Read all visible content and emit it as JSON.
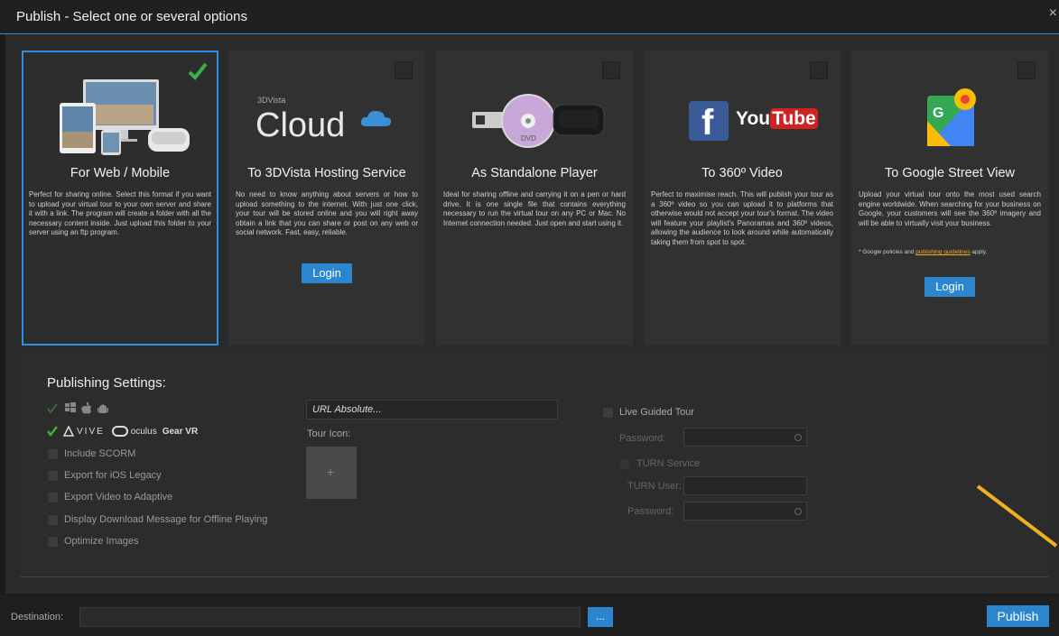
{
  "window": {
    "title": "Publish - Select one or several options",
    "close": "×"
  },
  "cards": [
    {
      "title": "For Web / Mobile",
      "checked": true,
      "desc": "Perfect for sharing online. Select this format if you want to upload your virtual tour to your own server and share it with a link. The program will create a folder with all the necessary content inside. Just upload this folder to your server using an ftp program."
    },
    {
      "title": "To 3DVista Hosting Service",
      "checked": false,
      "logo_small": "3DVista",
      "logo_big": "Cloud",
      "desc": "No need to know anything about servers or how to upload something to the internet. With just one click, your tour will be stored online and you will right away obtain a link that you can share or post on any web or social network. Fast, easy, reliable.",
      "login": "Login"
    },
    {
      "title": "As Standalone Player",
      "checked": false,
      "desc": "Ideal for sharing offline and carrying it on a pen or hard drive. It is one single file that contains everything necessary to run the virtual tour on any PC or Mac. No Internet connection needed. Just open and start using it.",
      "dvd": "DVD"
    },
    {
      "title": "To 360º Video",
      "checked": false,
      "logo_f": "f",
      "logo_you": "You",
      "logo_tube": "Tube",
      "desc": "Perfect to maximise reach. This will publish your tour as a 360º video so you can upload it to platforms that otherwise would not accept your tour's format. The video will feature your playlist's Panoramas and 360º videos, allowing the audience to look around while automatically taking them from spot to spot."
    },
    {
      "title": "To Google Street View",
      "checked": false,
      "logo_g": "G",
      "desc": "Upload your virtual tour onto the most used search engine worldwide. When searching for your business on Google, your customers will see the 360º imagery and will be able to virtually visit your business.",
      "note_prefix": "* Google policies and ",
      "note_link": "publishing guidelines",
      "note_suffix": " apply.",
      "login": "Login"
    }
  ],
  "settings": {
    "title": "Publishing Settings:",
    "vr_labels": {
      "vive": "VIVE",
      "oculus": "oculus",
      "gearvr": "Gear VR"
    },
    "options": [
      "Include SCORM",
      "Export for iOS Legacy",
      "Export Video to Adaptive",
      "Display Download Message for Offline Playing",
      "Optimize Images"
    ],
    "url_placeholder": "URL Absolute...",
    "tour_icon_label": "Tour Icon:",
    "tour_icon_plus": "+",
    "live_guided_tour": "Live Guided Tour",
    "password_label": "Password:",
    "turn_service": "TURN Service",
    "turn_user": "TURN User:",
    "password2_label": "Password:"
  },
  "footer": {
    "destination_label": "Destination:",
    "browse": "...",
    "publish": "Publish"
  },
  "colors": {
    "accent": "#2b86cf",
    "check": "#3cb043",
    "annotation": "#f0b020"
  }
}
